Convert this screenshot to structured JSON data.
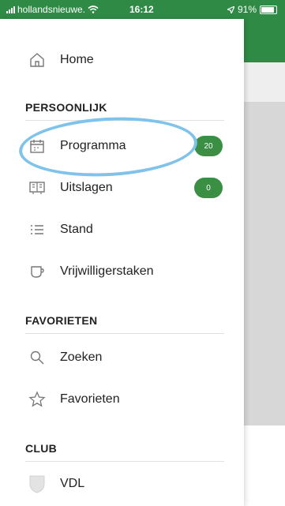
{
  "status_bar": {
    "carrier": "hollandsnieuwe.",
    "time": "16:12",
    "battery": "91%"
  },
  "menu": {
    "home": {
      "label": "Home",
      "icon": "home-icon"
    },
    "sections": {
      "persoonlijk": "PERSOONLIJK",
      "favorieten": "FAVORIETEN",
      "club": "CLUB"
    },
    "programma": {
      "label": "Programma",
      "badge": "20",
      "icon": "calendar-icon"
    },
    "uitslagen": {
      "label": "Uitslagen",
      "badge": "0",
      "icon": "scoreboard-icon"
    },
    "stand": {
      "label": "Stand",
      "icon": "list-icon"
    },
    "vrijwilligerstaken": {
      "label": "Vrijwilligerstaken",
      "icon": "cup-icon"
    },
    "zoeken": {
      "label": "Zoeken",
      "icon": "search-icon"
    },
    "favorieten_item": {
      "label": "Favorieten",
      "icon": "star-icon"
    },
    "club_item": {
      "label": "VDL",
      "icon": "club-logo"
    }
  },
  "colors": {
    "header_green": "#2f8a46",
    "badge_green": "#3a8f45",
    "highlight_blue": "#7fc2ea"
  }
}
